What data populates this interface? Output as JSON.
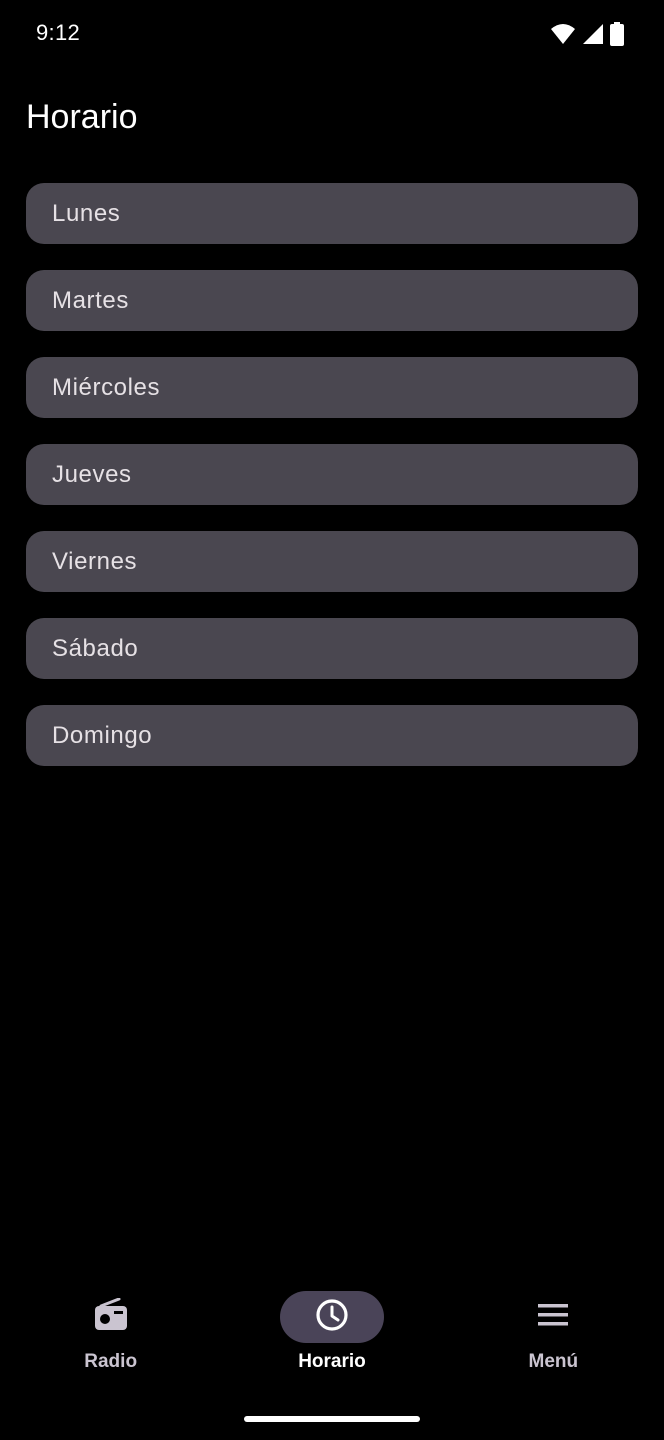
{
  "status_bar": {
    "time": "9:12",
    "icons": [
      "wifi-icon",
      "signal-icon",
      "battery-icon"
    ]
  },
  "page": {
    "title": "Horario"
  },
  "days": [
    {
      "label": "Lunes"
    },
    {
      "label": "Martes"
    },
    {
      "label": "Miércoles"
    },
    {
      "label": "Jueves"
    },
    {
      "label": "Viernes"
    },
    {
      "label": "Sábado"
    },
    {
      "label": "Domingo"
    }
  ],
  "bottom_nav": {
    "items": [
      {
        "label": "Radio",
        "icon": "radio-icon",
        "active": false
      },
      {
        "label": "Horario",
        "icon": "clock-icon",
        "active": true
      },
      {
        "label": "Menú",
        "icon": "menu-icon",
        "active": false
      }
    ]
  },
  "colors": {
    "background": "#000000",
    "card": "#4a4750",
    "active_indicator": "#4a4458",
    "text": "#e6e1e5"
  }
}
